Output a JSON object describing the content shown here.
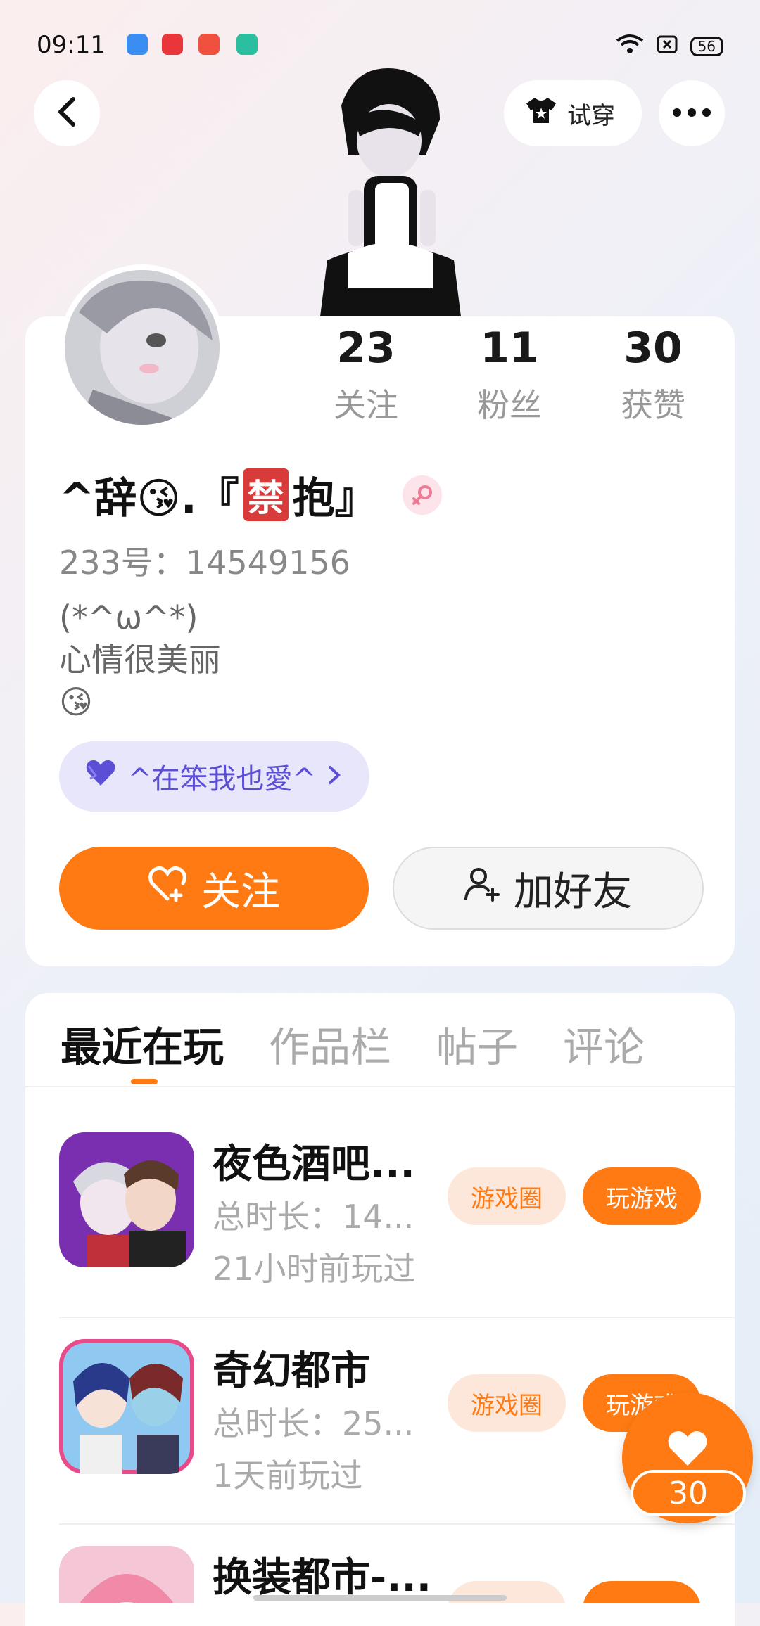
{
  "status_bar": {
    "time": "09:11",
    "battery": "56",
    "app_icon_colors": [
      "#3a8ef2",
      "#e8363a",
      "#f0513e",
      "#2bbfa0"
    ]
  },
  "header": {
    "back_icon": "chevron-left-icon",
    "tryon_label": "试穿",
    "more_icon": "more-icon"
  },
  "stats": [
    {
      "value": "23",
      "label": "关注"
    },
    {
      "value": "11",
      "label": "粉丝"
    },
    {
      "value": "30",
      "label": "获赞"
    }
  ],
  "profile": {
    "name_prefix": "^辞😘.『",
    "name_ban": "禁",
    "name_suffix": "抱』",
    "uid": "233号：14549156",
    "bio_lines": [
      "(*^ω^*)",
      "心情很美丽",
      "😘"
    ],
    "tag_label": "^在笨我也愛^",
    "follow_label": "关注",
    "add_friend_label": "加好友"
  },
  "tabs": [
    "最近在玩",
    "作品栏",
    "帖子",
    "评论"
  ],
  "games": [
    {
      "name": "夜色酒吧...",
      "duration": "总时长：14...",
      "last_played": "21小时前玩过",
      "circle_label": "游戏圈",
      "play_label": "玩游戏"
    },
    {
      "name": "奇幻都市",
      "duration": "总时长：25...",
      "last_played": "1天前玩过",
      "circle_label": "游戏圈",
      "play_label": "玩游戏"
    },
    {
      "name": "换装都市-...",
      "duration": "",
      "last_played": "",
      "circle_label": "",
      "play_label": ""
    }
  ],
  "like_fab": {
    "count": "30"
  },
  "colors": {
    "accent": "#ff7a12",
    "tag_bg": "#e8e6fb",
    "tag_text": "#5b4fd6"
  }
}
